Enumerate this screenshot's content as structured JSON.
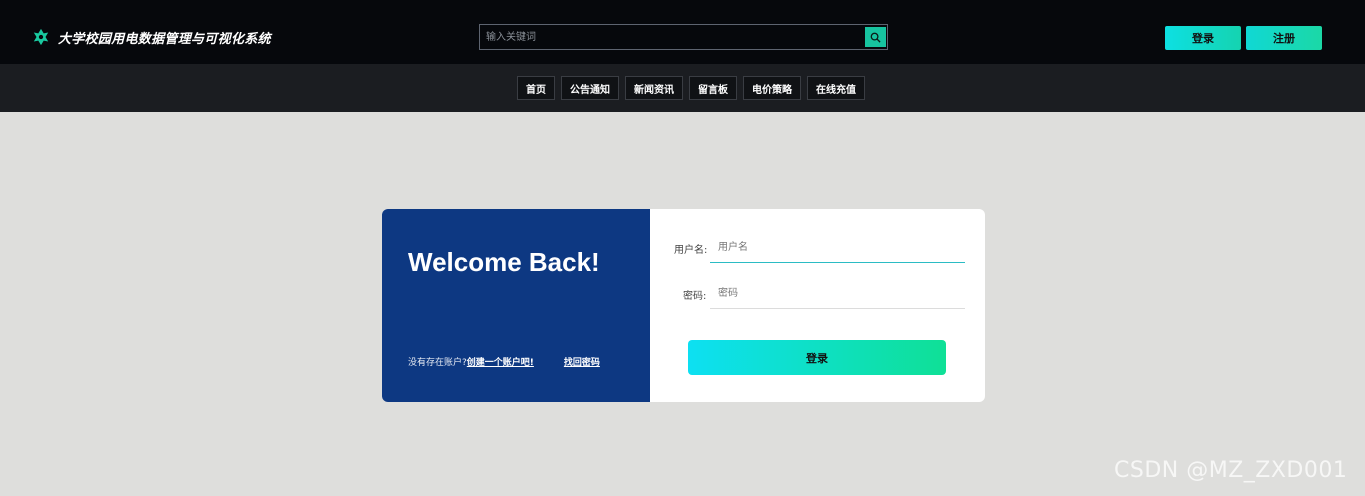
{
  "header": {
    "brand_title": "大学校园用电数据管理与可视化系统",
    "brand_icon": "leaf-icon",
    "search": {
      "placeholder": "输入关键词",
      "value": "",
      "button_icon": "search-icon"
    },
    "login_label": "登录",
    "register_label": "注册"
  },
  "nav": {
    "items": [
      {
        "label": "首页"
      },
      {
        "label": "公告通知"
      },
      {
        "label": "新闻资讯"
      },
      {
        "label": "留言板"
      },
      {
        "label": "电价策略"
      },
      {
        "label": "在线充值"
      }
    ]
  },
  "login_card": {
    "welcome": "Welcome Back!",
    "no_account_text": "没有存在账户?",
    "create_account_link": "创建一个账户吧!",
    "forgot_password_link": "找回密码",
    "username_label": "用户名:",
    "username_placeholder": "用户名",
    "password_label": "密码:",
    "password_placeholder": "密码",
    "submit_label": "登录"
  },
  "watermark": "CSDN @MZ_ZXD001",
  "colors": {
    "topbar": "#06080c",
    "navbar": "#1b1d21",
    "page_background": "#dededc",
    "card_left": "#0d3882",
    "accent_teal": "#17c4a0",
    "accent_cyan": "#0de0f2"
  }
}
